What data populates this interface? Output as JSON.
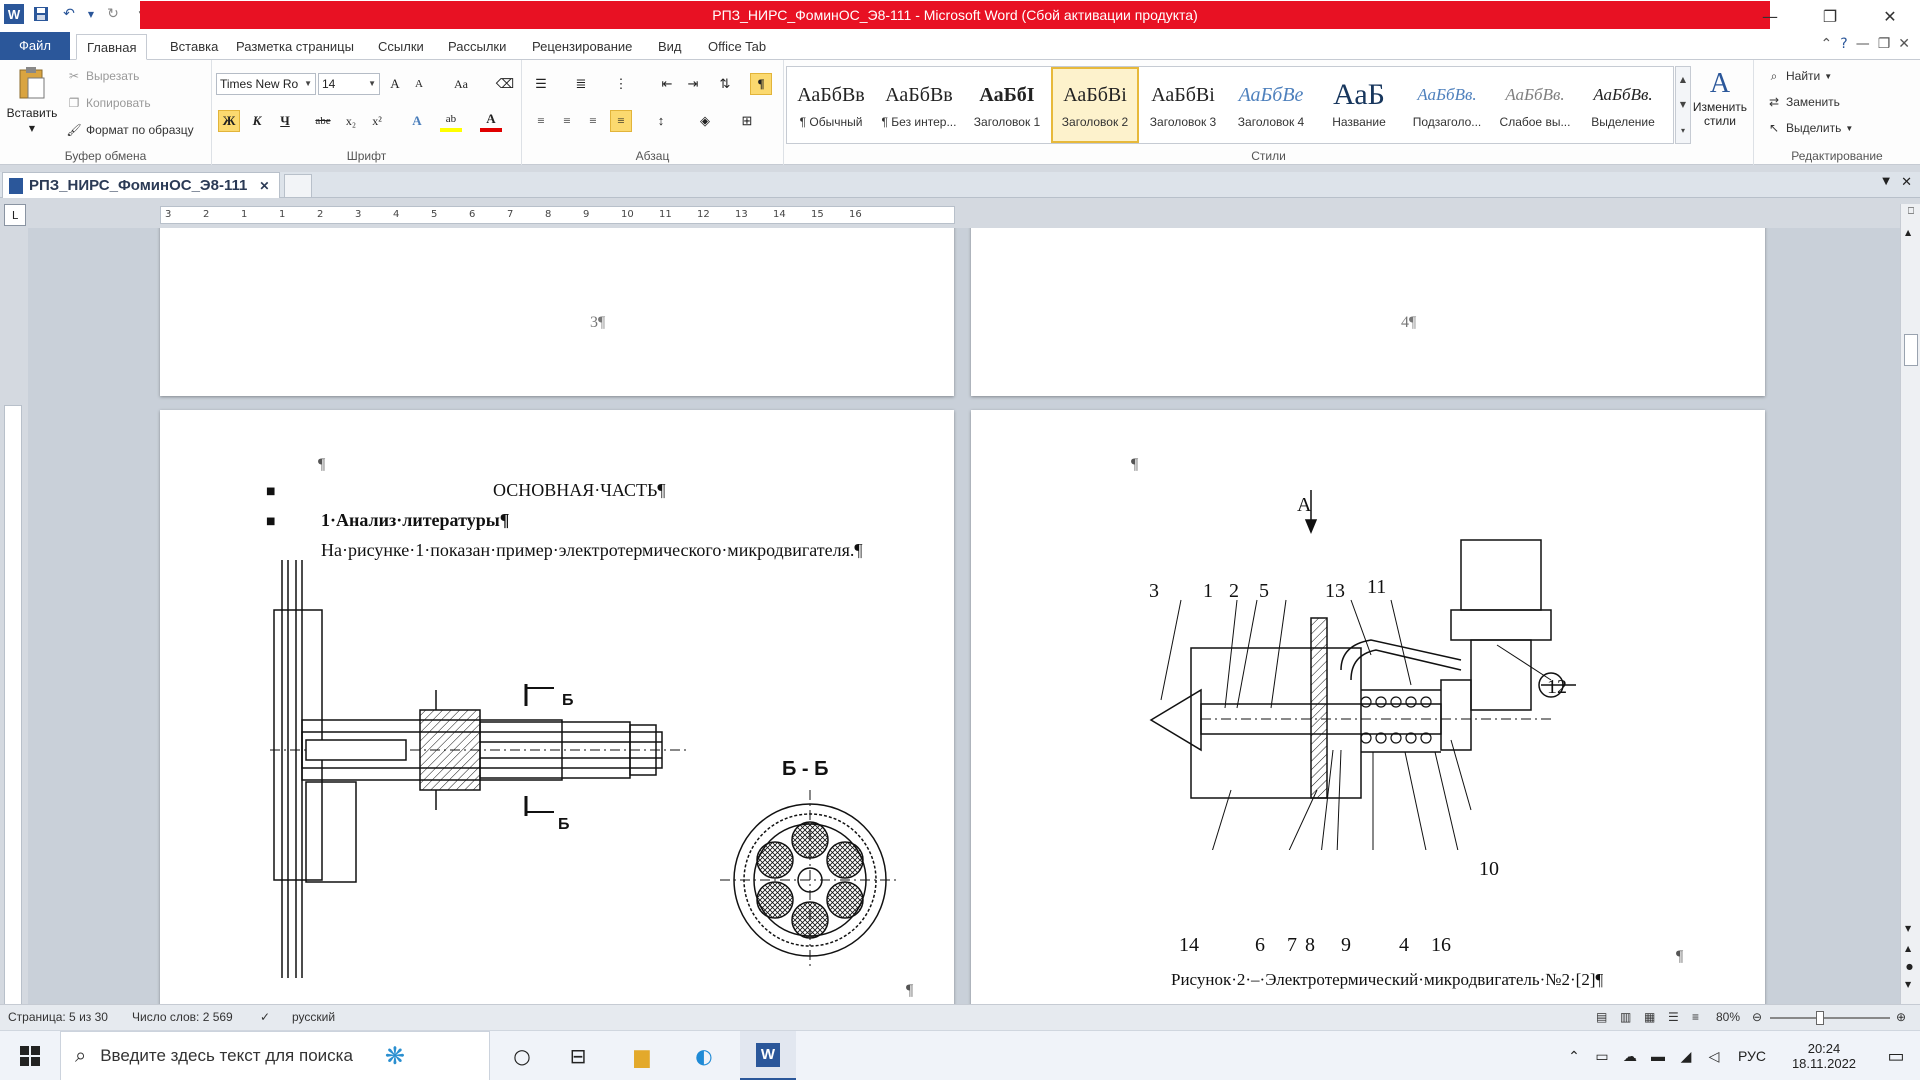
{
  "window": {
    "title": "РПЗ_НИРС_ФоминОС_Э8-111  -  Microsoft Word (Сбой активации продукта)",
    "app_icon": "W"
  },
  "ribbon_tabs": [
    "Файл",
    "Главная",
    "Вставка",
    "Разметка страницы",
    "Ссылки",
    "Рассылки",
    "Рецензирование",
    "Вид",
    "Office Tab"
  ],
  "clipboard": {
    "paste": "Вставить",
    "cut": "Вырезать",
    "copy": "Копировать",
    "format_painter": "Формат по образцу",
    "label": "Буфер обмена"
  },
  "font": {
    "name": "Times New Ro",
    "size": "14",
    "label": "Шрифт",
    "grow": "A",
    "shrink": "A",
    "case": "Aa",
    "bold": "Ж",
    "italic": "К",
    "underline": "Ч",
    "strike": "abe",
    "sub": "x₂",
    "sup": "x²",
    "effects": "A",
    "highlight": "ab",
    "color": "A"
  },
  "paragraph": {
    "label": "Абзац",
    "pilcrow": "¶"
  },
  "styles": {
    "label": "Стили",
    "items": [
      {
        "sample": "АаБбВв",
        "name": "¶ Обычный"
      },
      {
        "sample": "АаБбВв",
        "name": "¶ Без интер..."
      },
      {
        "sample": "АаБбI",
        "name": "Заголовок 1"
      },
      {
        "sample": "АаБбВі",
        "name": "Заголовок 2"
      },
      {
        "sample": "АаБбВі",
        "name": "Заголовок 3"
      },
      {
        "sample": "АаБбВе",
        "name": "Заголовок 4"
      },
      {
        "sample": "АаБ",
        "name": "Название"
      },
      {
        "sample": "АаБбВв.",
        "name": "Подзаголо..."
      },
      {
        "sample": "АаБбВв.",
        "name": "Слабое вы..."
      },
      {
        "sample": "АаБбВв.",
        "name": "Выделение"
      }
    ],
    "change_styles": "Изменить стили"
  },
  "editing": {
    "label": "Редактирование",
    "find": "Найти",
    "replace": "Заменить",
    "select": "Выделить"
  },
  "doc_tab": {
    "name": "РПЗ_НИРС_ФоминОС_Э8-111"
  },
  "ruler_numbers": [
    "3",
    "2",
    "1",
    "1",
    "2",
    "3",
    "4",
    "5",
    "6",
    "7",
    "8",
    "9",
    "10",
    "11",
    "12",
    "13",
    "14",
    "15",
    "16"
  ],
  "pages": {
    "p3_number": "3¶",
    "p4_number": "4¶",
    "p5": {
      "pilcrow_top": "¶",
      "heading_main": "ОСНОВНАЯ·ЧАСТЬ¶",
      "heading_1": "1·Анализ·литературы¶",
      "body_1": "На·рисунке·1·показан·пример·электротермического·микродвигателя.¶",
      "section_label_top": "Б",
      "section_label_bottom": "Б",
      "section_title": "Б - Б",
      "pilcrow_bottom": "¶"
    },
    "p6": {
      "pilcrow_top": "¶",
      "arrow_label": "А",
      "labels": [
        "3",
        "1",
        "2",
        "5",
        "13",
        "11",
        "12",
        "10",
        "14",
        "6",
        "7",
        "8",
        "9",
        "4",
        "16"
      ],
      "caption": "Рисунок·2·–·Электротермический·микродвигатель·№2·[2]¶",
      "pilcrow_right": "¶"
    }
  },
  "status": {
    "page": "Страница: 5 из 30",
    "words": "Число слов: 2 569",
    "language": "русский",
    "zoom": "80%"
  },
  "taskbar": {
    "search_placeholder": "Введите здесь текст для поиска",
    "lang": "РУС",
    "time": "20:24",
    "date": "18.11.2022"
  }
}
